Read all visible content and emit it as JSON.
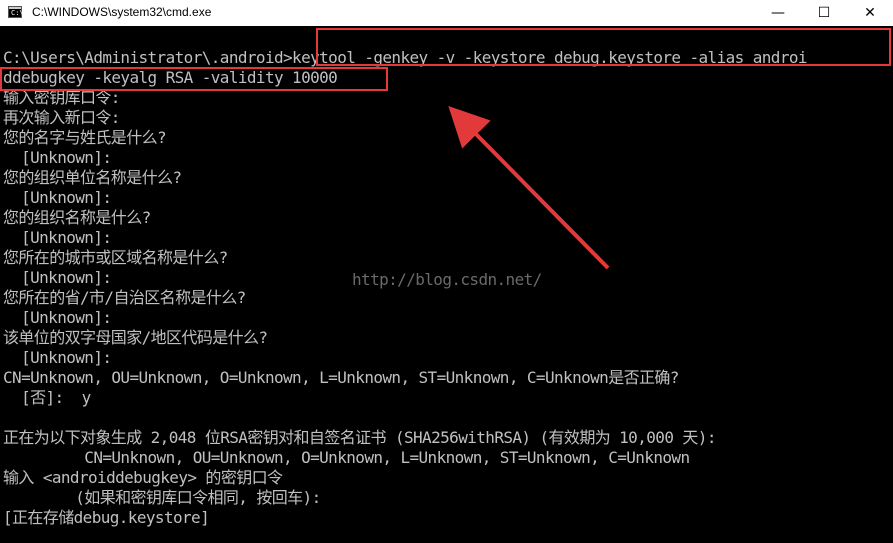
{
  "window": {
    "title": "C:\\WINDOWS\\system32\\cmd.exe",
    "icon": "cmd-icon",
    "icon_text": "C:\\",
    "controls": {
      "minimize": "—",
      "maximize": "☐",
      "close": "✕"
    }
  },
  "console": {
    "lines": [
      "C:\\Users\\Administrator\\.android>keytool -genkey -v -keystore debug.keystore -alias androi",
      "ddebugkey -keyalg RSA -validity 10000",
      "输入密钥库口令:",
      "再次输入新口令:",
      "您的名字与姓氏是什么?",
      "  [Unknown]:",
      "您的组织单位名称是什么?",
      "  [Unknown]:",
      "您的组织名称是什么?",
      "  [Unknown]:",
      "您所在的城市或区域名称是什么?",
      "  [Unknown]:",
      "您所在的省/市/自治区名称是什么?",
      "  [Unknown]:",
      "该单位的双字母国家/地区代码是什么?",
      "  [Unknown]:",
      "CN=Unknown, OU=Unknown, O=Unknown, L=Unknown, ST=Unknown, C=Unknown是否正确?",
      "  [否]:  y",
      "",
      "正在为以下对象生成 2,048 位RSA密钥对和自签名证书 (SHA256withRSA) (有效期为 10,000 天):",
      "         CN=Unknown, OU=Unknown, O=Unknown, L=Unknown, ST=Unknown, C=Unknown",
      "输入 <androiddebugkey> 的密钥口令",
      "        (如果和密钥库口令相同, 按回车):",
      "[正在存储debug.keystore]"
    ],
    "watermark": "http://blog.csdn.net/"
  },
  "annotation": {
    "color": "#e23a3a"
  }
}
